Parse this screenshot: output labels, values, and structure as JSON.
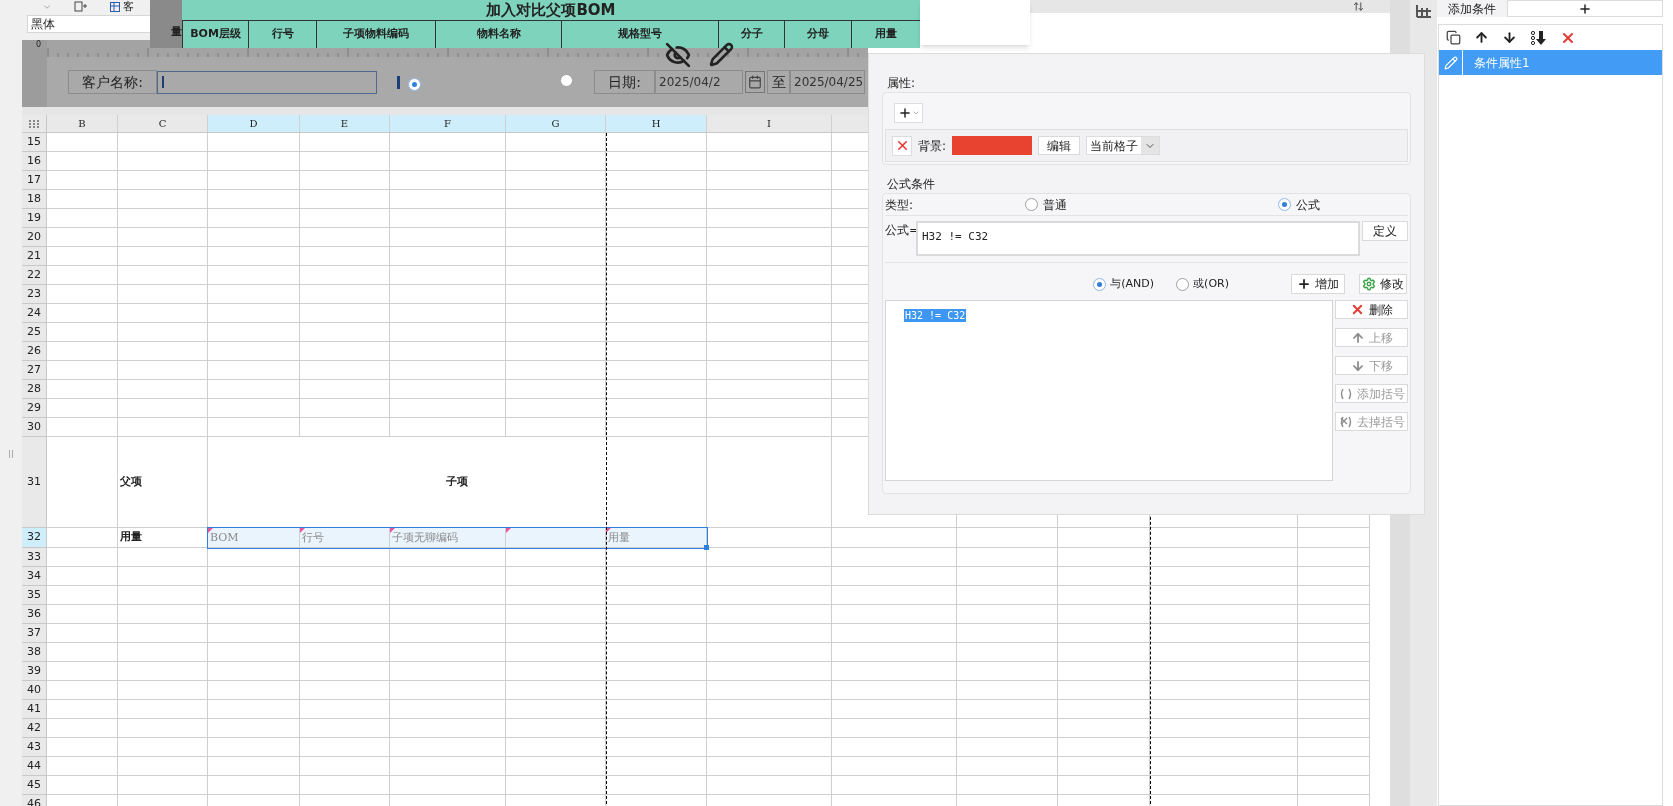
{
  "toolbar": {
    "font": "黑体",
    "cut_label": "客"
  },
  "popup": {
    "title": "加入对比父项BOM",
    "cut_column": "量",
    "columns": [
      "BOM层级",
      "行号",
      "子项物料编码",
      "物料名称",
      "规格型号",
      "分子",
      "分母",
      "用量"
    ]
  },
  "parameters": {
    "ruler_origin": "0",
    "customer_label": "客户名称:",
    "options": [
      {
        "selected": true
      },
      {
        "selected": false
      }
    ],
    "date_label": "日期:",
    "date_from": "2025/04/2",
    "to_label": "至",
    "date_to": "2025/04/25"
  },
  "sheet": {
    "columns": [
      {
        "label": "B",
        "selected": false
      },
      {
        "label": "C",
        "selected": false
      },
      {
        "label": "D",
        "selected": true
      },
      {
        "label": "E",
        "selected": true
      },
      {
        "label": "F",
        "selected": true
      },
      {
        "label": "G",
        "selected": true
      },
      {
        "label": "H",
        "selected": true
      },
      {
        "label": "I",
        "selected": false
      }
    ],
    "rows": [
      {
        "number": "15",
        "selected": false,
        "kind": "plain"
      },
      {
        "number": "16",
        "selected": false,
        "kind": "plain"
      },
      {
        "number": "17",
        "selected": false,
        "kind": "plain"
      },
      {
        "number": "18",
        "selected": false,
        "kind": "plain"
      },
      {
        "number": "19",
        "selected": false,
        "kind": "plain"
      },
      {
        "number": "20",
        "selected": false,
        "kind": "plain"
      },
      {
        "number": "21",
        "selected": false,
        "kind": "plain"
      },
      {
        "number": "22",
        "selected": false,
        "kind": "plain"
      },
      {
        "number": "23",
        "selected": false,
        "kind": "plain"
      },
      {
        "number": "24",
        "selected": false,
        "kind": "plain"
      },
      {
        "number": "25",
        "selected": false,
        "kind": "plain"
      },
      {
        "number": "26",
        "selected": false,
        "kind": "plain"
      },
      {
        "number": "27",
        "selected": false,
        "kind": "plain"
      },
      {
        "number": "28",
        "selected": false,
        "kind": "plain"
      },
      {
        "number": "29",
        "selected": false,
        "kind": "plain"
      },
      {
        "number": "30",
        "selected": false,
        "kind": "plain"
      },
      {
        "number": "31",
        "selected": false,
        "kind": "group",
        "parent": "父项",
        "child": "子项"
      },
      {
        "number": "32",
        "selected": true,
        "kind": "mapping",
        "label": "用量",
        "cells": [
          {
            "text": "BOM",
            "flagged": true
          },
          {
            "text": "行号",
            "flagged": true
          },
          {
            "text": "子项无聊编码",
            "flagged": true
          },
          {
            "flagged": true
          },
          {
            "text": "用量",
            "flagged": true
          }
        ]
      },
      {
        "number": "33",
        "selected": false,
        "kind": "plain"
      },
      {
        "number": "34",
        "selected": false,
        "kind": "plain"
      },
      {
        "number": "35",
        "selected": false,
        "kind": "plain"
      },
      {
        "number": "36",
        "selected": false,
        "kind": "plain"
      },
      {
        "number": "37",
        "selected": false,
        "kind": "plain"
      },
      {
        "number": "38",
        "selected": false,
        "kind": "plain"
      },
      {
        "number": "39",
        "selected": false,
        "kind": "plain"
      },
      {
        "number": "40",
        "selected": false,
        "kind": "plain"
      },
      {
        "number": "41",
        "selected": false,
        "kind": "plain"
      },
      {
        "number": "42",
        "selected": false,
        "kind": "plain"
      },
      {
        "number": "43",
        "selected": false,
        "kind": "plain"
      },
      {
        "number": "44",
        "selected": false,
        "kind": "plain"
      },
      {
        "number": "45",
        "selected": false,
        "kind": "plain"
      },
      {
        "number": "46",
        "selected": false,
        "kind": "plain"
      }
    ]
  },
  "dialog": {
    "attributes_label": "属性:",
    "attributes": [
      {
        "label": "背景:",
        "color": "#e84330",
        "edit_button": "编辑",
        "scope": "当前格子"
      }
    ],
    "condition_title": "公式条件",
    "type_label": "类型:",
    "types": [
      {
        "label": "普通",
        "selected": false
      },
      {
        "label": "公式",
        "selected": true
      }
    ],
    "formula_label": "公式=",
    "formula": "H32 != C32",
    "define_button": "定义",
    "logic": [
      {
        "label": "与(AND)",
        "selected": true
      },
      {
        "label": "或(OR)",
        "selected": false
      }
    ],
    "add_button": "增加",
    "modify_button": "修改",
    "conditions": [
      {
        "text": "H32 != C32",
        "selected": true
      }
    ],
    "actions": [
      {
        "kind": "delete",
        "label": "删除",
        "disabled": false
      },
      {
        "kind": "up",
        "label": "上移",
        "disabled": true
      },
      {
        "kind": "down",
        "label": "下移",
        "disabled": true
      },
      {
        "kind": "add_paren",
        "label": "添加括号",
        "disabled": true
      },
      {
        "kind": "remove_paren",
        "label": "去掉括号",
        "disabled": true
      }
    ]
  },
  "conditions_panel": {
    "tabs": [
      {
        "kind": "text",
        "label": "添加条件",
        "selected": true
      },
      {
        "kind": "add",
        "selected": false
      }
    ],
    "items": [
      {
        "label": "条件属性1",
        "selected": true
      }
    ]
  }
}
